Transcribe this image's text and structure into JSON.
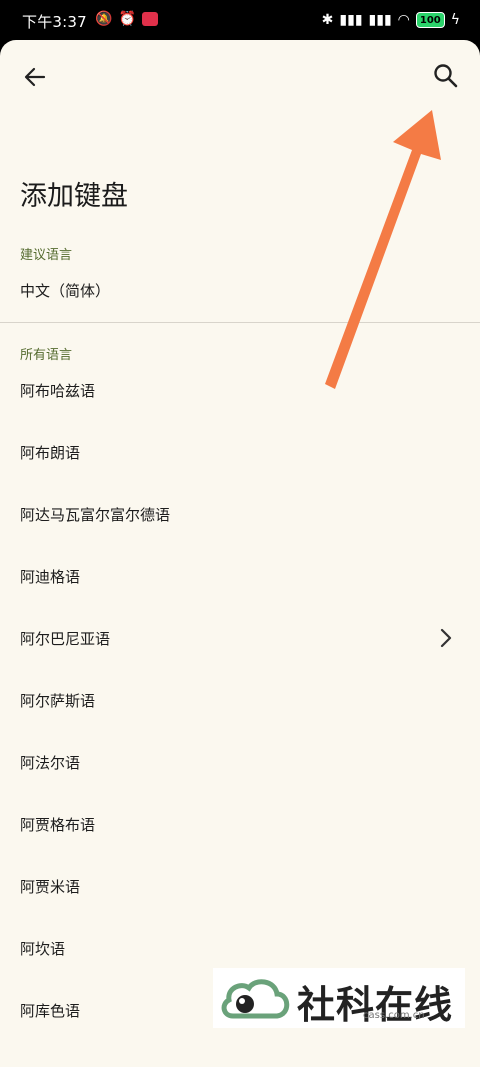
{
  "status_bar": {
    "time": "下午3:37",
    "battery": "100"
  },
  "header": {
    "title": "添加键盘"
  },
  "sections": {
    "suggested": "建议语言",
    "all": "所有语言"
  },
  "suggested_items": [
    "中文（简体）"
  ],
  "languages": [
    "阿布哈兹语",
    "阿布朗语",
    "阿达马瓦富尔富尔德语",
    "阿迪格语",
    "阿尔巴尼亚语",
    "阿尔萨斯语",
    "阿法尔语",
    "阿贾格布语",
    "阿贾米语",
    "阿坎语",
    "阿库色语"
  ],
  "watermark": {
    "text": "社科在线",
    "url": "cass.com.cn"
  },
  "colors": {
    "background": "#fbf8ef",
    "section_label": "#556b2f",
    "annotation_arrow": "#f47b45"
  }
}
